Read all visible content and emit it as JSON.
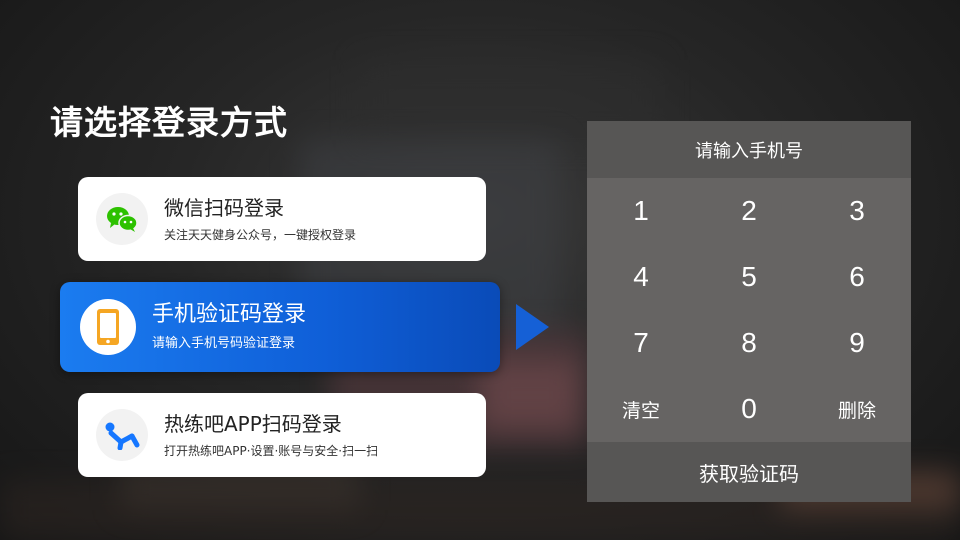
{
  "page": {
    "title": "请选择登录方式"
  },
  "login_options": [
    {
      "name": "微信扫码登录",
      "desc": "关注天天健身公众号，一键授权登录",
      "icon": "wechat-icon",
      "selected": false
    },
    {
      "name": "手机验证码登录",
      "desc": "请输入手机号码验证登录",
      "icon": "mobile-phone-icon",
      "selected": true
    },
    {
      "name": "热练吧APP扫码登录",
      "desc": "打开热练吧APP·设置·账号与安全·扫一扫",
      "icon": "app-logo-icon",
      "selected": false
    }
  ],
  "keypad": {
    "placeholder": "请输入手机号",
    "keys": [
      "1",
      "2",
      "3",
      "4",
      "5",
      "6",
      "7",
      "8",
      "9",
      "清空",
      "0",
      "删除"
    ],
    "submit_label": "获取验证码"
  },
  "colors": {
    "accent": "#1b7cf0",
    "accent_dark": "#0a4bb8",
    "wechat_green": "#2dc100",
    "phone_orange": "#f5a623",
    "keypad_bg": "#666463",
    "keypad_bar": "#575655"
  }
}
